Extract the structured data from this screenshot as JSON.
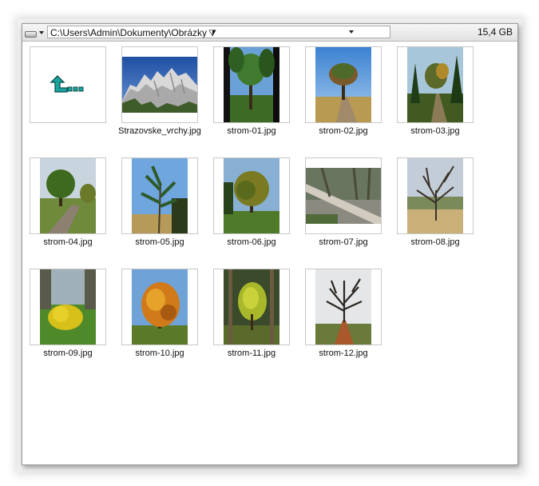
{
  "path_bar": {
    "path": "C:\\Users\\Admin\\Dokumenty\\Obrázky",
    "free_space": "15,4 GB"
  },
  "items": [
    {
      "label": "",
      "icon": "up-directory-icon"
    },
    {
      "label": "Strazovske_vrchy.jpg"
    },
    {
      "label": "strom-01.jpg"
    },
    {
      "label": "strom-02.jpg"
    },
    {
      "label": "strom-03.jpg"
    },
    {
      "label": "strom-04.jpg"
    },
    {
      "label": "strom-05.jpg"
    },
    {
      "label": "strom-06.jpg"
    },
    {
      "label": "strom-07.jpg"
    },
    {
      "label": "strom-08.jpg"
    },
    {
      "label": "strom-09.jpg"
    },
    {
      "label": "strom-10.jpg"
    },
    {
      "label": "strom-11.jpg"
    },
    {
      "label": "strom-12.jpg"
    }
  ],
  "colors": {
    "up_arrow": "#1e9e9a",
    "panel_border": "#9a9a9a"
  }
}
